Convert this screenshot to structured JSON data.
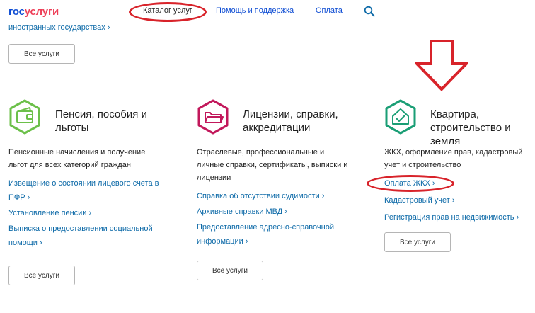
{
  "header": {
    "logo_part1": "гос",
    "logo_part2": "услуги",
    "nav": {
      "catalog": "Каталог услуг",
      "help": "Помощь и поддержка",
      "payment": "Оплата"
    }
  },
  "top": {
    "link": "иностранных государствах ›",
    "all_services": "Все услуги"
  },
  "categories": [
    {
      "title_line1": "Пенсия, пособия и",
      "title_line2": "льготы",
      "desc_line1": "Пенсионные начисления и получение",
      "desc_line2": "льгот для всех категорий граждан",
      "links": [
        [
          "Извещение о состоянии лицевого счета в",
          "ПФР ›"
        ],
        [
          "Установление пенсии ›"
        ],
        [
          "Выписка о предоставлении социальной",
          "помощи ›"
        ]
      ],
      "button": "Все услуги",
      "color": "#6cc04a"
    },
    {
      "title_line1": "Лицензии, справки,",
      "title_line2": "аккредитации",
      "desc_line1": "Отраслевые, профессиональные и",
      "desc_line2": "личные справки, сертификаты, выписки и",
      "desc_line3": "лицензии",
      "links": [
        [
          "Справка об отсутствии судимости ›"
        ],
        [
          "Архивные справки МВД ›"
        ],
        [
          "Предоставление адресно-справочной",
          "информации ›"
        ]
      ],
      "button": "Все услуги",
      "color": "#c2185b"
    },
    {
      "title_line1": "Квартира,",
      "title_line2": "строительство и",
      "title_line3": "земля",
      "desc_line1": "ЖКХ, оформление прав, кадастровый",
      "desc_line2": "учет и строительство",
      "links": [
        [
          "Оплата ЖКХ ›"
        ],
        [
          "Кадастровый учет ›"
        ],
        [
          "Регистрация прав на недвижимость ›"
        ]
      ],
      "button": "Все услуги",
      "color": "#1a9e75"
    }
  ],
  "annotation_color": "#d8232a"
}
